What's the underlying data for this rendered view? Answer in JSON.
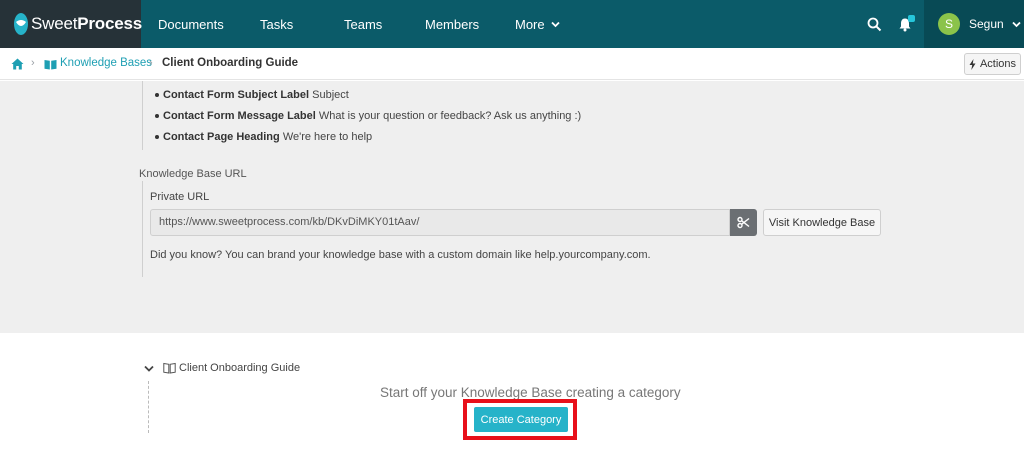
{
  "brand": {
    "name_light": "Sweet",
    "name_bold": "Process"
  },
  "nav": {
    "items": [
      {
        "label": "Documents"
      },
      {
        "label": "Tasks"
      },
      {
        "label": "Teams"
      },
      {
        "label": "Members"
      },
      {
        "label": "More"
      }
    ],
    "icons": [
      "search-icon",
      "bell-icon"
    ]
  },
  "user": {
    "initial": "S",
    "name": "Segun"
  },
  "breadcrumb": {
    "home_icon": "home-icon",
    "section": "Knowledge Bases",
    "current": "Client Onboarding Guide"
  },
  "actions": {
    "label": "Actions"
  },
  "settings": [
    {
      "key": "Contact Form Subject Label",
      "value": "Subject"
    },
    {
      "key": "Contact Form Message Label",
      "value": "What is your question or feedback? Ask us anything :)"
    },
    {
      "key": "Contact Page Heading",
      "value": "We're here to help"
    }
  ],
  "kb_url": {
    "section_label": "Knowledge Base URL",
    "private_label": "Private URL",
    "url": "https://www.sweetprocess.com/kb/DKvDiMKY01tAav/",
    "visit_label": "Visit Knowledge Base",
    "tip": "Did you know? You can brand your knowledge base with a custom domain like help.yourcompany.com."
  },
  "categories": {
    "kb_title": "Client Onboarding Guide",
    "empty_message": "Start off your Knowledge Base creating a category",
    "create_label": "Create Category"
  },
  "colors": {
    "nav_bg": "#0b5b69",
    "logo_bg": "#263238",
    "accent": "#26b3c9",
    "highlight": "#e8101a",
    "avatar": "#8bc34a"
  }
}
